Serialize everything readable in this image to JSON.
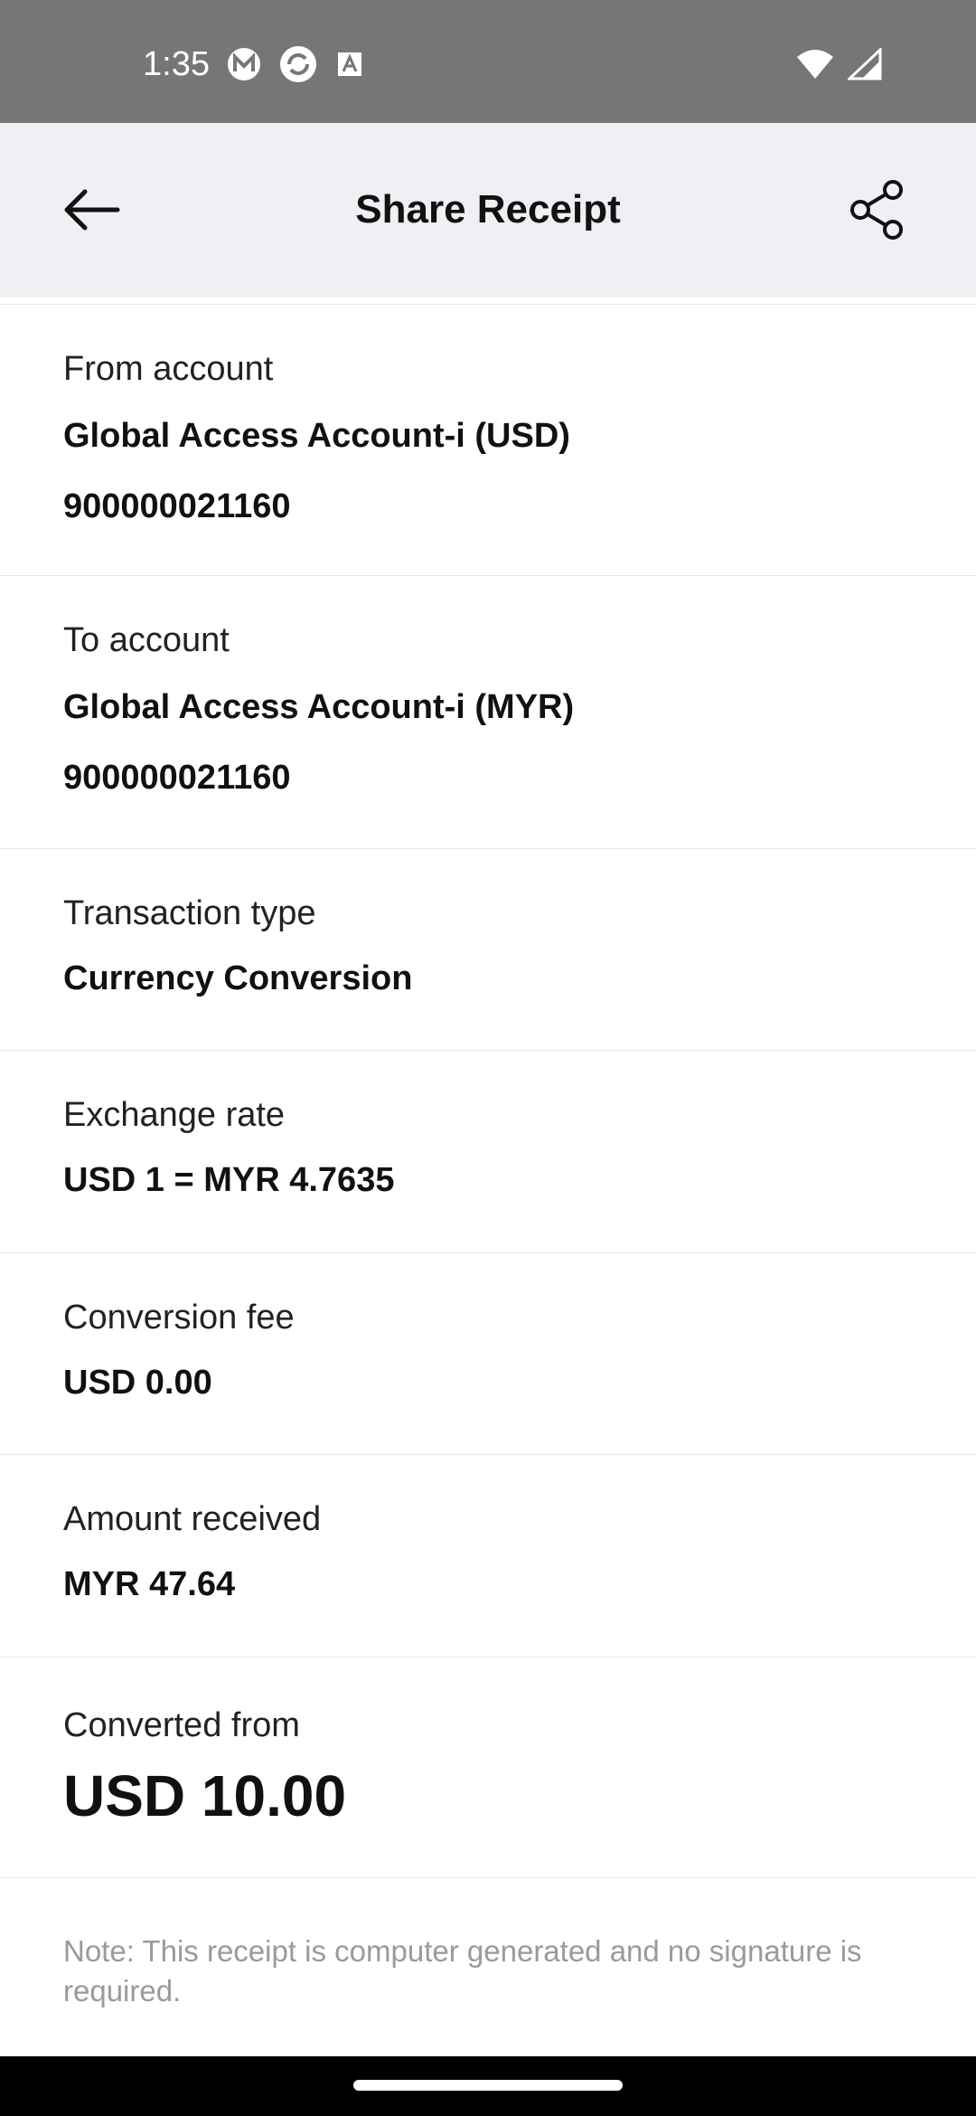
{
  "status_bar": {
    "time": "1:35",
    "icons_left": [
      "m-app-icon",
      "sync-app-icon",
      "font-app-icon"
    ],
    "icons_right": [
      "wifi-icon",
      "signal-icon"
    ]
  },
  "header": {
    "title": "Share Receipt",
    "back_icon": "arrow-left-icon",
    "share_icon": "share-icon"
  },
  "receipt": {
    "from": {
      "label": "From account",
      "name": "Global Access Account-i (USD)",
      "number": "900000021160"
    },
    "to": {
      "label": "To account",
      "name": "Global Access Account-i (MYR)",
      "number": "900000021160"
    },
    "transaction_type": {
      "label": "Transaction type",
      "value": "Currency Conversion"
    },
    "exchange_rate": {
      "label": "Exchange rate",
      "value": "USD 1 = MYR 4.7635"
    },
    "conversion_fee": {
      "label": "Conversion fee",
      "value": "USD 0.00"
    },
    "amount_received": {
      "label": "Amount received",
      "value": "MYR 47.64"
    },
    "converted_from": {
      "label": "Converted from",
      "value": "USD 10.00"
    },
    "note": "Note: This receipt is computer generated and no signature is required."
  }
}
